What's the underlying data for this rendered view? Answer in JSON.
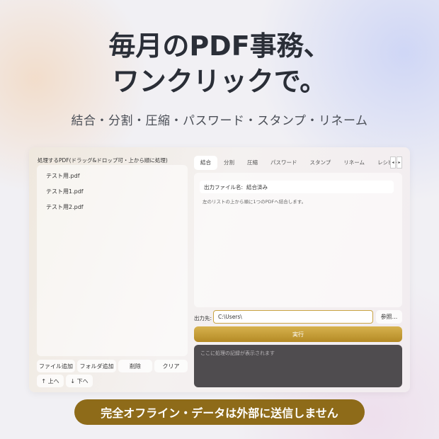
{
  "headline": {
    "line1": "毎月のPDF事務、",
    "line2": "ワンクリックで。"
  },
  "subline": "結合・分割・圧縮・パスワード・スタンプ・リネーム",
  "window": {
    "left_caption": "処理するPDF(ドラッグ&ドロップ可・上から順に処理)",
    "files": [
      "テスト用.pdf",
      "テスト用1.pdf",
      "テスト用2.pdf"
    ],
    "buttons": {
      "add_file": "ファイル追加",
      "add_folder": "フォルダ追加",
      "delete": "削除",
      "clear": "クリア",
      "move_up": "↑ 上へ",
      "move_down": "↓ 下へ"
    },
    "tabs": [
      {
        "label": "結合",
        "active": true
      },
      {
        "label": "分割",
        "active": false
      },
      {
        "label": "圧縮",
        "active": false
      },
      {
        "label": "パスワード",
        "active": false
      },
      {
        "label": "スタンプ",
        "active": false
      },
      {
        "label": "リネーム",
        "active": false
      },
      {
        "label": "レシピ(一括",
        "active": false
      }
    ],
    "tab_scroll_left": "◂",
    "tab_scroll_right": "▸",
    "merge_panel": {
      "output_name_label": "出力ファイル名:",
      "output_name_value": "結合済み",
      "hint": "左のリストの上から順に1つのPDFへ結合します。"
    },
    "output": {
      "label": "出力先:",
      "value": "C:\\Users\\",
      "browse": "参照..."
    },
    "run_label": "実行",
    "log_placeholder": "ここに処理の記録が表示されます"
  },
  "banner": "完全オフライン・データは外部に送信しません",
  "colors": {
    "accent_gold": "#c9a343",
    "banner_bg": "#8e6b19",
    "log_bg": "#4f4c4f"
  }
}
